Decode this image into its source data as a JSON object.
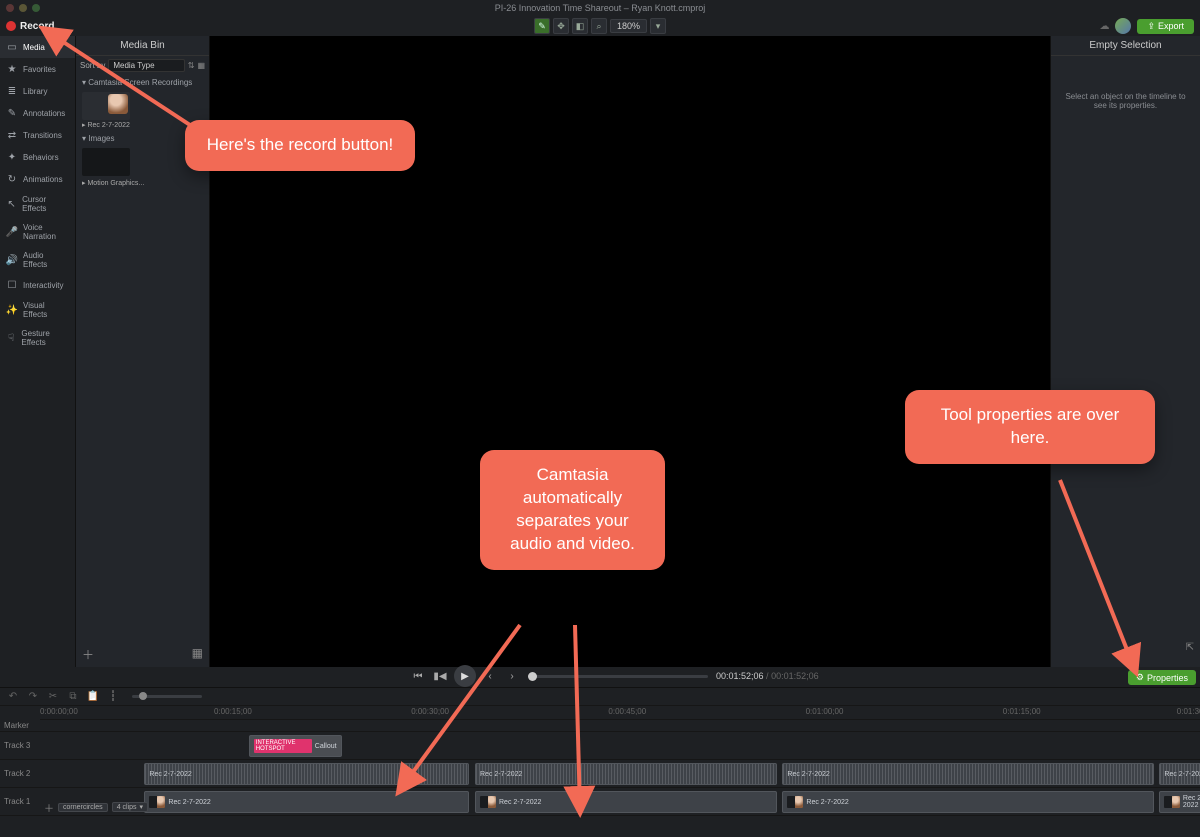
{
  "title": "PI-26 Innovation Time Shareout – Ryan Knott.cmproj",
  "record_label": "Record",
  "zoom": "180%",
  "export_label": "Export",
  "sidebar": {
    "items": [
      {
        "label": "Media"
      },
      {
        "label": "Favorites"
      },
      {
        "label": "Library"
      },
      {
        "label": "Annotations"
      },
      {
        "label": "Transitions"
      },
      {
        "label": "Behaviors"
      },
      {
        "label": "Animations"
      },
      {
        "label": "Cursor Effects"
      },
      {
        "label": "Voice Narration"
      },
      {
        "label": "Audio Effects"
      },
      {
        "label": "Interactivity"
      },
      {
        "label": "Visual Effects"
      },
      {
        "label": "Gesture Effects"
      }
    ]
  },
  "mediabin": {
    "title": "Media Bin",
    "sort_label": "Sort by",
    "sort_value": "Media Type",
    "cat1": "Camtasia Screen Recordings",
    "thumb1": "Rec 2-7-2022",
    "cat2": "Images",
    "thumb2": "Motion Graphics..."
  },
  "properties": {
    "title": "Empty Selection",
    "message": "Select an object on the timeline to see its properties.",
    "button": "Properties"
  },
  "transport": {
    "current": "00:01:52;06",
    "total": "00:01:52;06"
  },
  "timeline": {
    "marker": "Marker",
    "tracks": [
      "Track 3",
      "Track 2",
      "Track 1"
    ],
    "ruler": [
      "0:00:00;00",
      "0:00:15;00",
      "0:00:30;00",
      "0:00:45;00",
      "0:01:00;00",
      "0:01:15;00",
      "0:01:30;00"
    ],
    "callout_badge": "INTERACTIVE HOTSPOT",
    "callout": "Callout",
    "clip": "Rec 2-7-2022",
    "sub1": "cornercircles",
    "sub2": "4 clips"
  },
  "notes": {
    "a": "Here's the record button!",
    "b": "Camtasia automatically separates your audio and video.",
    "c": "Tool properties are over here."
  }
}
